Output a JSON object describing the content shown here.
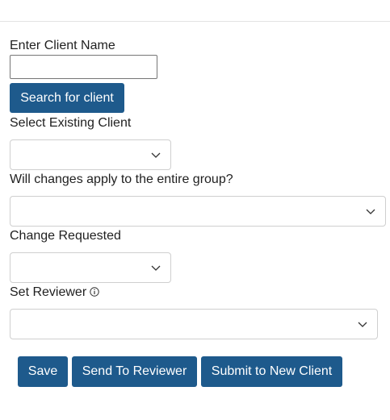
{
  "client_search": {
    "label": "Enter Client Name",
    "value": "",
    "button_label": "Search for client"
  },
  "existing_client": {
    "label": "Select Existing Client",
    "selected": ""
  },
  "group_changes": {
    "label": "Will changes apply to the entire group?",
    "selected": ""
  },
  "change_requested": {
    "label": "Change Requested",
    "selected": ""
  },
  "reviewer": {
    "label": "Set Reviewer",
    "info_icon": "info-circle-icon",
    "selected": ""
  },
  "actions": {
    "save": "Save",
    "send_to_reviewer": "Send To Reviewer",
    "submit_new_client": "Submit to New Client"
  },
  "colors": {
    "button_bg": "#1e5a8c",
    "button_text": "#ffffff",
    "select_border": "#cfcfcf",
    "input_border": "#767676"
  }
}
